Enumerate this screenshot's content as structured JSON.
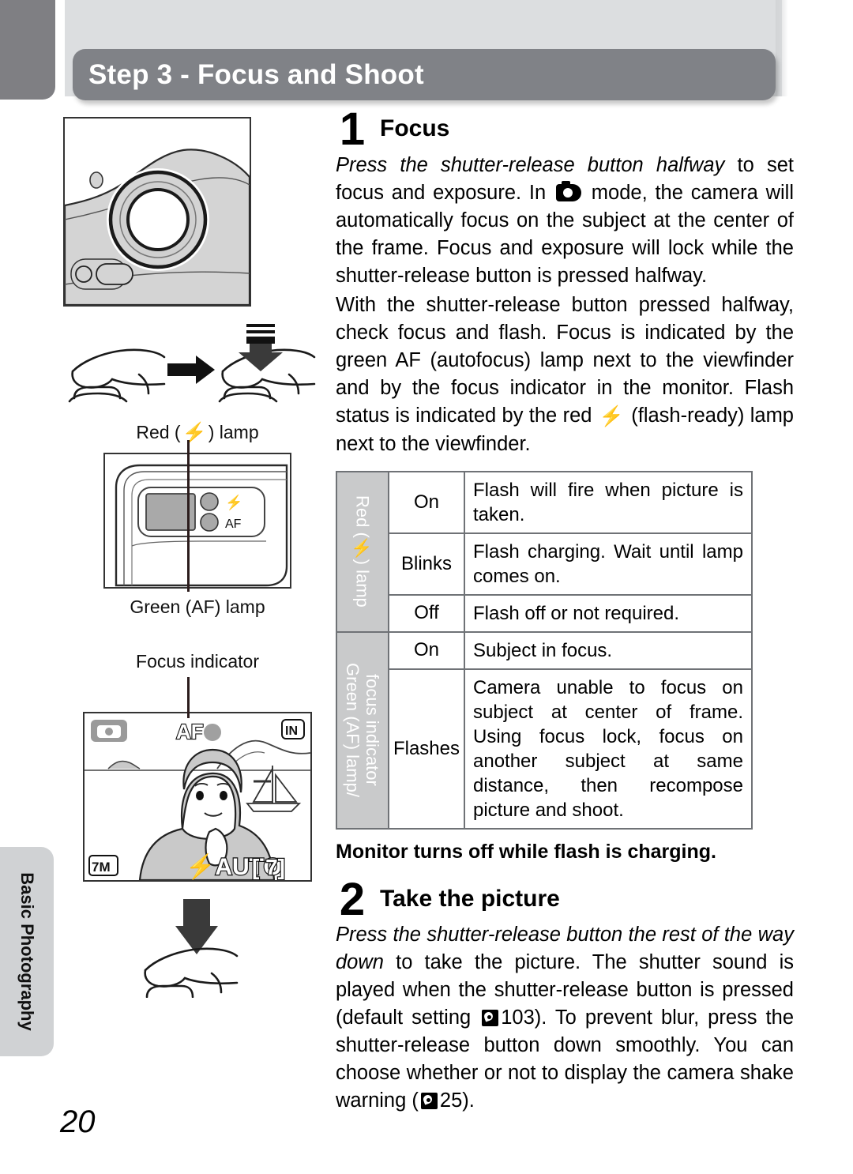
{
  "header": {
    "title": "Step 3 - Focus and Shoot",
    "bar_color": "#808287",
    "band_color": "#dcdee0"
  },
  "side_tab": {
    "label": "Basic Photography",
    "color": "#d0d2d4"
  },
  "page_number": "20",
  "figures": {
    "camera_front": {
      "name": "camera-front-lens-illustration"
    },
    "press_halfway": {
      "name": "finger-press-halfway-illustration",
      "caption": "Red (",
      "caption_icon": "⚡",
      "caption_end": ") lamp"
    },
    "camera_back": {
      "name": "camera-back-lamps-illustration",
      "lamp_flash_label": "⚡",
      "lamp_af_label": "AF",
      "caption": "Green (AF) lamp"
    },
    "focus_indicator": {
      "caption": "Focus indicator"
    },
    "monitor": {
      "mode_icon": "camera-mode-icon",
      "af_label": "AF",
      "memory_badge": "IN",
      "image_size": "7M",
      "flash_mode": "AUTO",
      "frames_remaining": "[    7]"
    },
    "press_full": {
      "name": "finger-press-full-illustration"
    }
  },
  "steps": [
    {
      "number": "1",
      "title": "Focus",
      "paragraph1_italic": "Press the shutter-release button halfway",
      "paragraph1_a": " to set focus and exposure. In ",
      "paragraph1_b": " mode, the camera will automatically focus on the subject at the center of the frame. Focus and exposure will lock while the shutter-release button is pressed halfway.",
      "paragraph2_a": "With the shutter-release button pressed halfway, check focus and flash. Focus is indicated by the green AF (autofocus) lamp next to the viewfinder and by the focus indicator in the monitor. Flash status is indicated by the red ",
      "paragraph2_b": " (flash-ready) lamp next to the viewfinder."
    },
    {
      "number": "2",
      "title": "Take the picture",
      "paragraph1_italic": "Press the shutter-release button the rest of the way down",
      "paragraph1_a": " to take the picture. The shutter sound is played when the shutter-release button is pressed (default setting ",
      "paragraph1_page1": "103",
      "paragraph1_b": "). To prevent blur, press the shutter-release button down smoothly. You can choose whether or not to display the camera shake warning (",
      "paragraph1_page2": "25",
      "paragraph1_c": ")."
    }
  ],
  "note": "Monitor turns off while flash is charging.",
  "status_table": {
    "groups": [
      {
        "header_lines": [
          "Red (⚡) lamp"
        ],
        "rows": [
          {
            "state": "On",
            "description": "Flash will fire when picture is taken."
          },
          {
            "state": "Blinks",
            "description": "Flash charging. Wait until lamp comes on."
          },
          {
            "state": "Off",
            "description": "Flash off or not required."
          }
        ]
      },
      {
        "header_lines": [
          "Green (AF) lamp/",
          "focus indicator"
        ],
        "rows": [
          {
            "state": "On",
            "description": "Subject in focus."
          },
          {
            "state": "Flashes",
            "description": "Camera unable to focus on subject at center of frame. Using focus lock, focus on another subject at same distance, then recompose picture and shoot."
          }
        ]
      }
    ]
  }
}
